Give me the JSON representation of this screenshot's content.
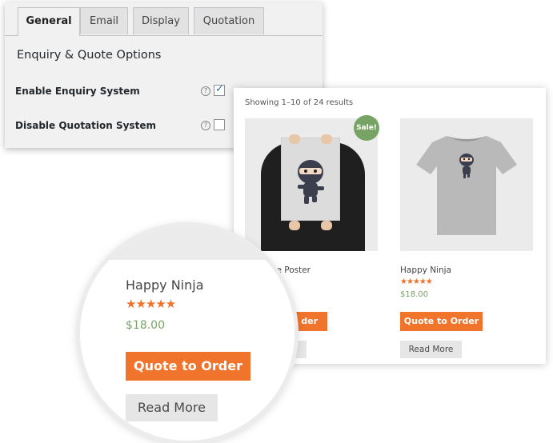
{
  "settings": {
    "tabs": [
      {
        "label": "General",
        "active": true
      },
      {
        "label": "Email",
        "active": false
      },
      {
        "label": "Display",
        "active": false
      },
      {
        "label": "Quotation",
        "active": false
      }
    ],
    "section_title": "Enquiry & Quote Options",
    "options": [
      {
        "label": "Enable Enquiry System",
        "help": "?",
        "checked": true
      },
      {
        "label": "Disable Quotation System",
        "help": "?",
        "checked": false
      }
    ],
    "check_glyph": "✓"
  },
  "shop": {
    "result_count": "Showing 1–10 of 24 results",
    "products": [
      {
        "title_partial": "e Poster",
        "badge": "Sale!",
        "quote_partial": "der",
        "image_icon": "ninja-poster-image"
      },
      {
        "title": "Happy Ninja",
        "stars": "★★★★★",
        "price": "$18.00",
        "quote_label": "Quote to Order",
        "read_more_label": "Read More",
        "image_icon": "ninja-tshirt-image"
      }
    ]
  },
  "magnifier": {
    "title": "Happy Ninja",
    "stars": "★★★★★",
    "price": "$18.00",
    "quote_label": "Quote to Order",
    "read_more_label": "Read More"
  },
  "colors": {
    "accent_orange": "#f1742c",
    "price_green": "#77a464",
    "sale_badge": "#77a464",
    "checkbox_blue": "#2271b1"
  }
}
